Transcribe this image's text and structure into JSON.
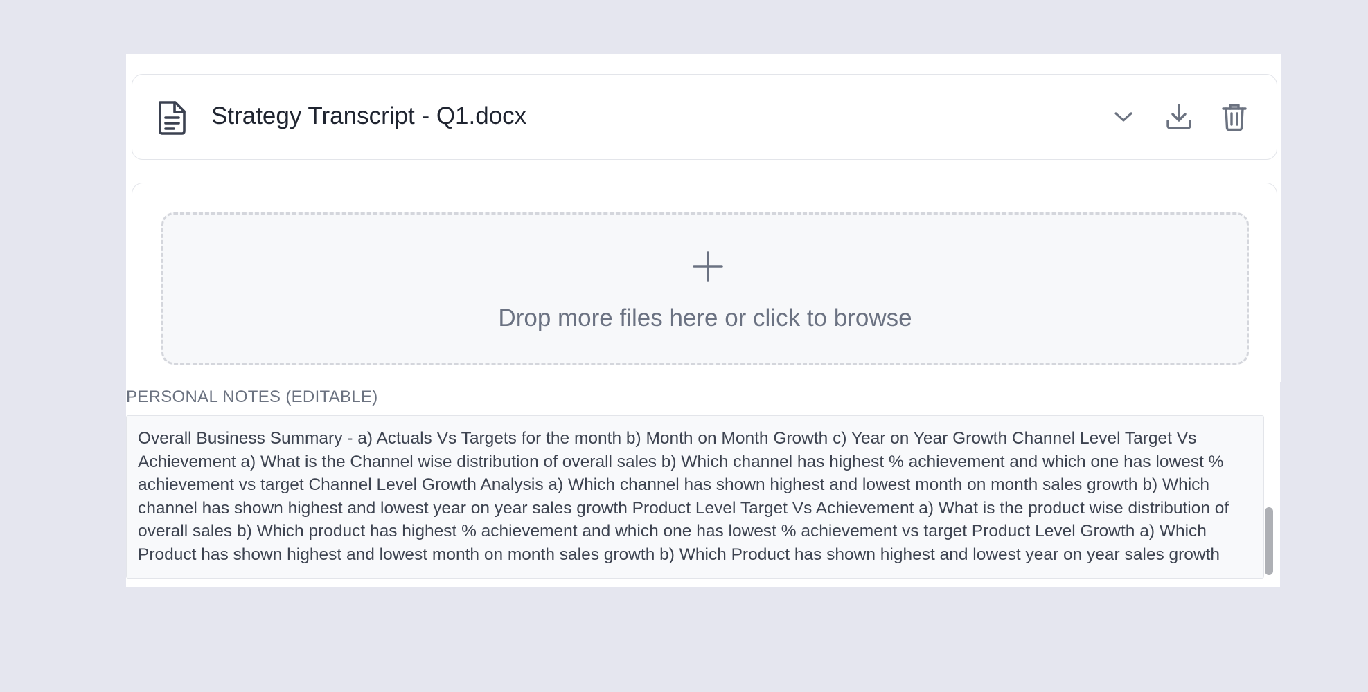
{
  "file": {
    "name": "Strategy Transcript - Q1.docx",
    "icon": "document-icon",
    "actions": [
      "chevron-down-icon",
      "download-icon",
      "trash-icon"
    ]
  },
  "upload": {
    "text": "Drop more files here or click to browse",
    "icon": "plus-icon"
  },
  "notes": {
    "label": "PERSONAL NOTES (EDITABLE)",
    "value": "Overall Business Summary - a) Actuals Vs Targets for the month b) Month on Month Growth c) Year on Year Growth Channel Level Target Vs Achievement a) What is the Channel wise distribution of overall sales b) Which channel has highest % achievement and which one has lowest % achievement vs target Channel Level Growth Analysis a) Which channel has shown highest and lowest month on month sales growth b) Which channel has shown highest and lowest year on year sales growth Product Level Target Vs Achievement a) What is the product wise distribution of overall sales b) Which product has highest % achievement and which one has lowest % achievement vs target Product Level Growth a) Which Product has shown highest and lowest month on month sales growth b) Which Product has shown highest and lowest year on year sales growth"
  },
  "colors": {
    "background": "#e5e6ef",
    "panel": "#ffffff",
    "text_primary": "#1f2430",
    "text_muted": "#6b7282",
    "border": "#e3e5ea"
  }
}
